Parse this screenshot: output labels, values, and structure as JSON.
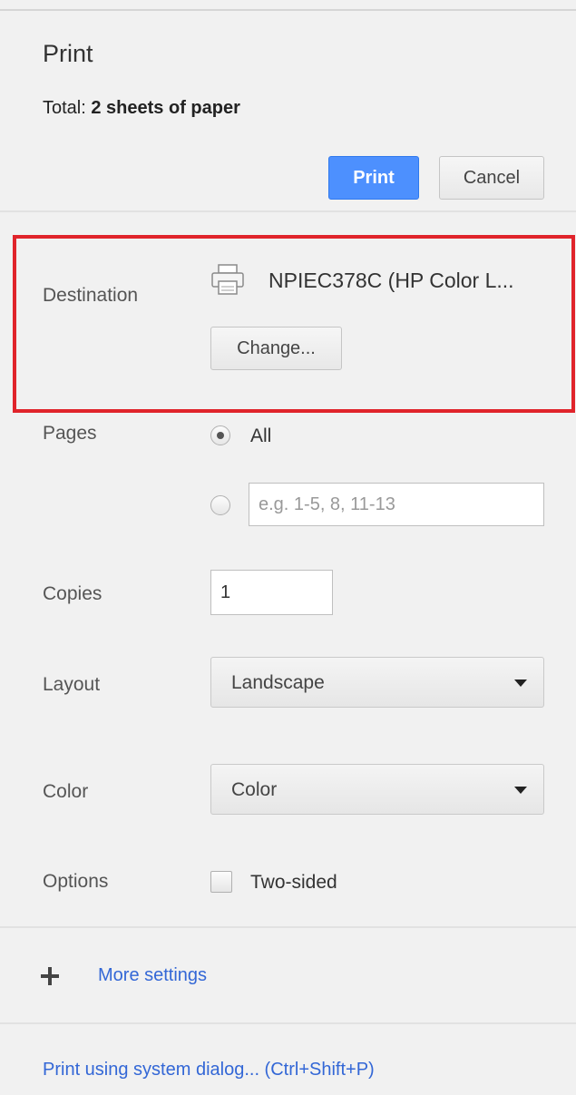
{
  "header": {
    "title": "Print",
    "summary_prefix": "Total:",
    "summary_value": "2 sheets of paper",
    "print_label": "Print",
    "cancel_label": "Cancel"
  },
  "destination": {
    "label": "Destination",
    "printer_name": "NPIEC378C (HP Color L...",
    "printer_icon": "printer-icon",
    "change_label": "Change..."
  },
  "pages": {
    "label": "Pages",
    "all_label": "All",
    "all_selected": true,
    "custom_placeholder": "e.g. 1-5, 8, 11-13",
    "custom_value": ""
  },
  "copies": {
    "label": "Copies",
    "value": "1"
  },
  "layout": {
    "label": "Layout",
    "selected": "Landscape"
  },
  "color": {
    "label": "Color",
    "selected": "Color"
  },
  "options": {
    "label": "Options",
    "two_sided_label": "Two-sided",
    "two_sided_checked": false
  },
  "footer": {
    "more_settings_label": "More settings",
    "system_dialog_label": "Print using system dialog... (Ctrl+Shift+P)"
  },
  "colors": {
    "primary_button": "#4d90fe",
    "highlight_border": "#e0242b",
    "link": "#3367d6",
    "background": "#f1f1f1"
  }
}
